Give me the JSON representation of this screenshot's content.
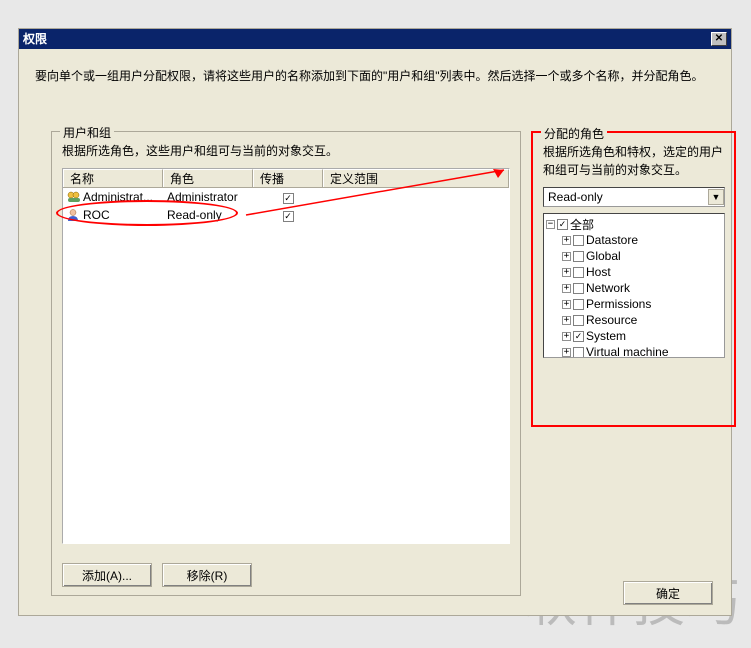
{
  "title": "权限",
  "intro": "要向单个或一组用户分配权限，请将这些用户的名称添加到下面的\"用户和组\"列表中。然后选择一个或多个名称，并分配角色。",
  "usersGroup": {
    "legend": "用户和组",
    "help": "根据所选角色，这些用户和组可与当前的对象交互。",
    "columns": {
      "c1": "名称",
      "c2": "角色",
      "c3": "传播",
      "c4": "定义范围"
    },
    "rows": [
      {
        "name": "Administrat...",
        "role": "Administrator",
        "propagate": true,
        "icon": "group"
      },
      {
        "name": "ROC",
        "role": "Read-only",
        "propagate": true,
        "icon": "user"
      }
    ],
    "addBtn": "添加(A)...",
    "removeBtn": "移除(R)"
  },
  "rolesGroup": {
    "legend": "分配的角色",
    "help": "根据所选角色和特权，选定的用户和组可与当前的对象交互。",
    "selected": "Read-only",
    "root": {
      "label": "全部",
      "checked": true
    },
    "items": [
      {
        "label": "Datastore",
        "checked": false
      },
      {
        "label": "Global",
        "checked": false
      },
      {
        "label": "Host",
        "checked": false
      },
      {
        "label": "Network",
        "checked": false
      },
      {
        "label": "Permissions",
        "checked": false
      },
      {
        "label": "Resource",
        "checked": false
      },
      {
        "label": "System",
        "checked": true
      },
      {
        "label": "Virtual machine",
        "checked": false
      }
    ]
  },
  "okBtn": "确定",
  "watermark": "软件技巧"
}
